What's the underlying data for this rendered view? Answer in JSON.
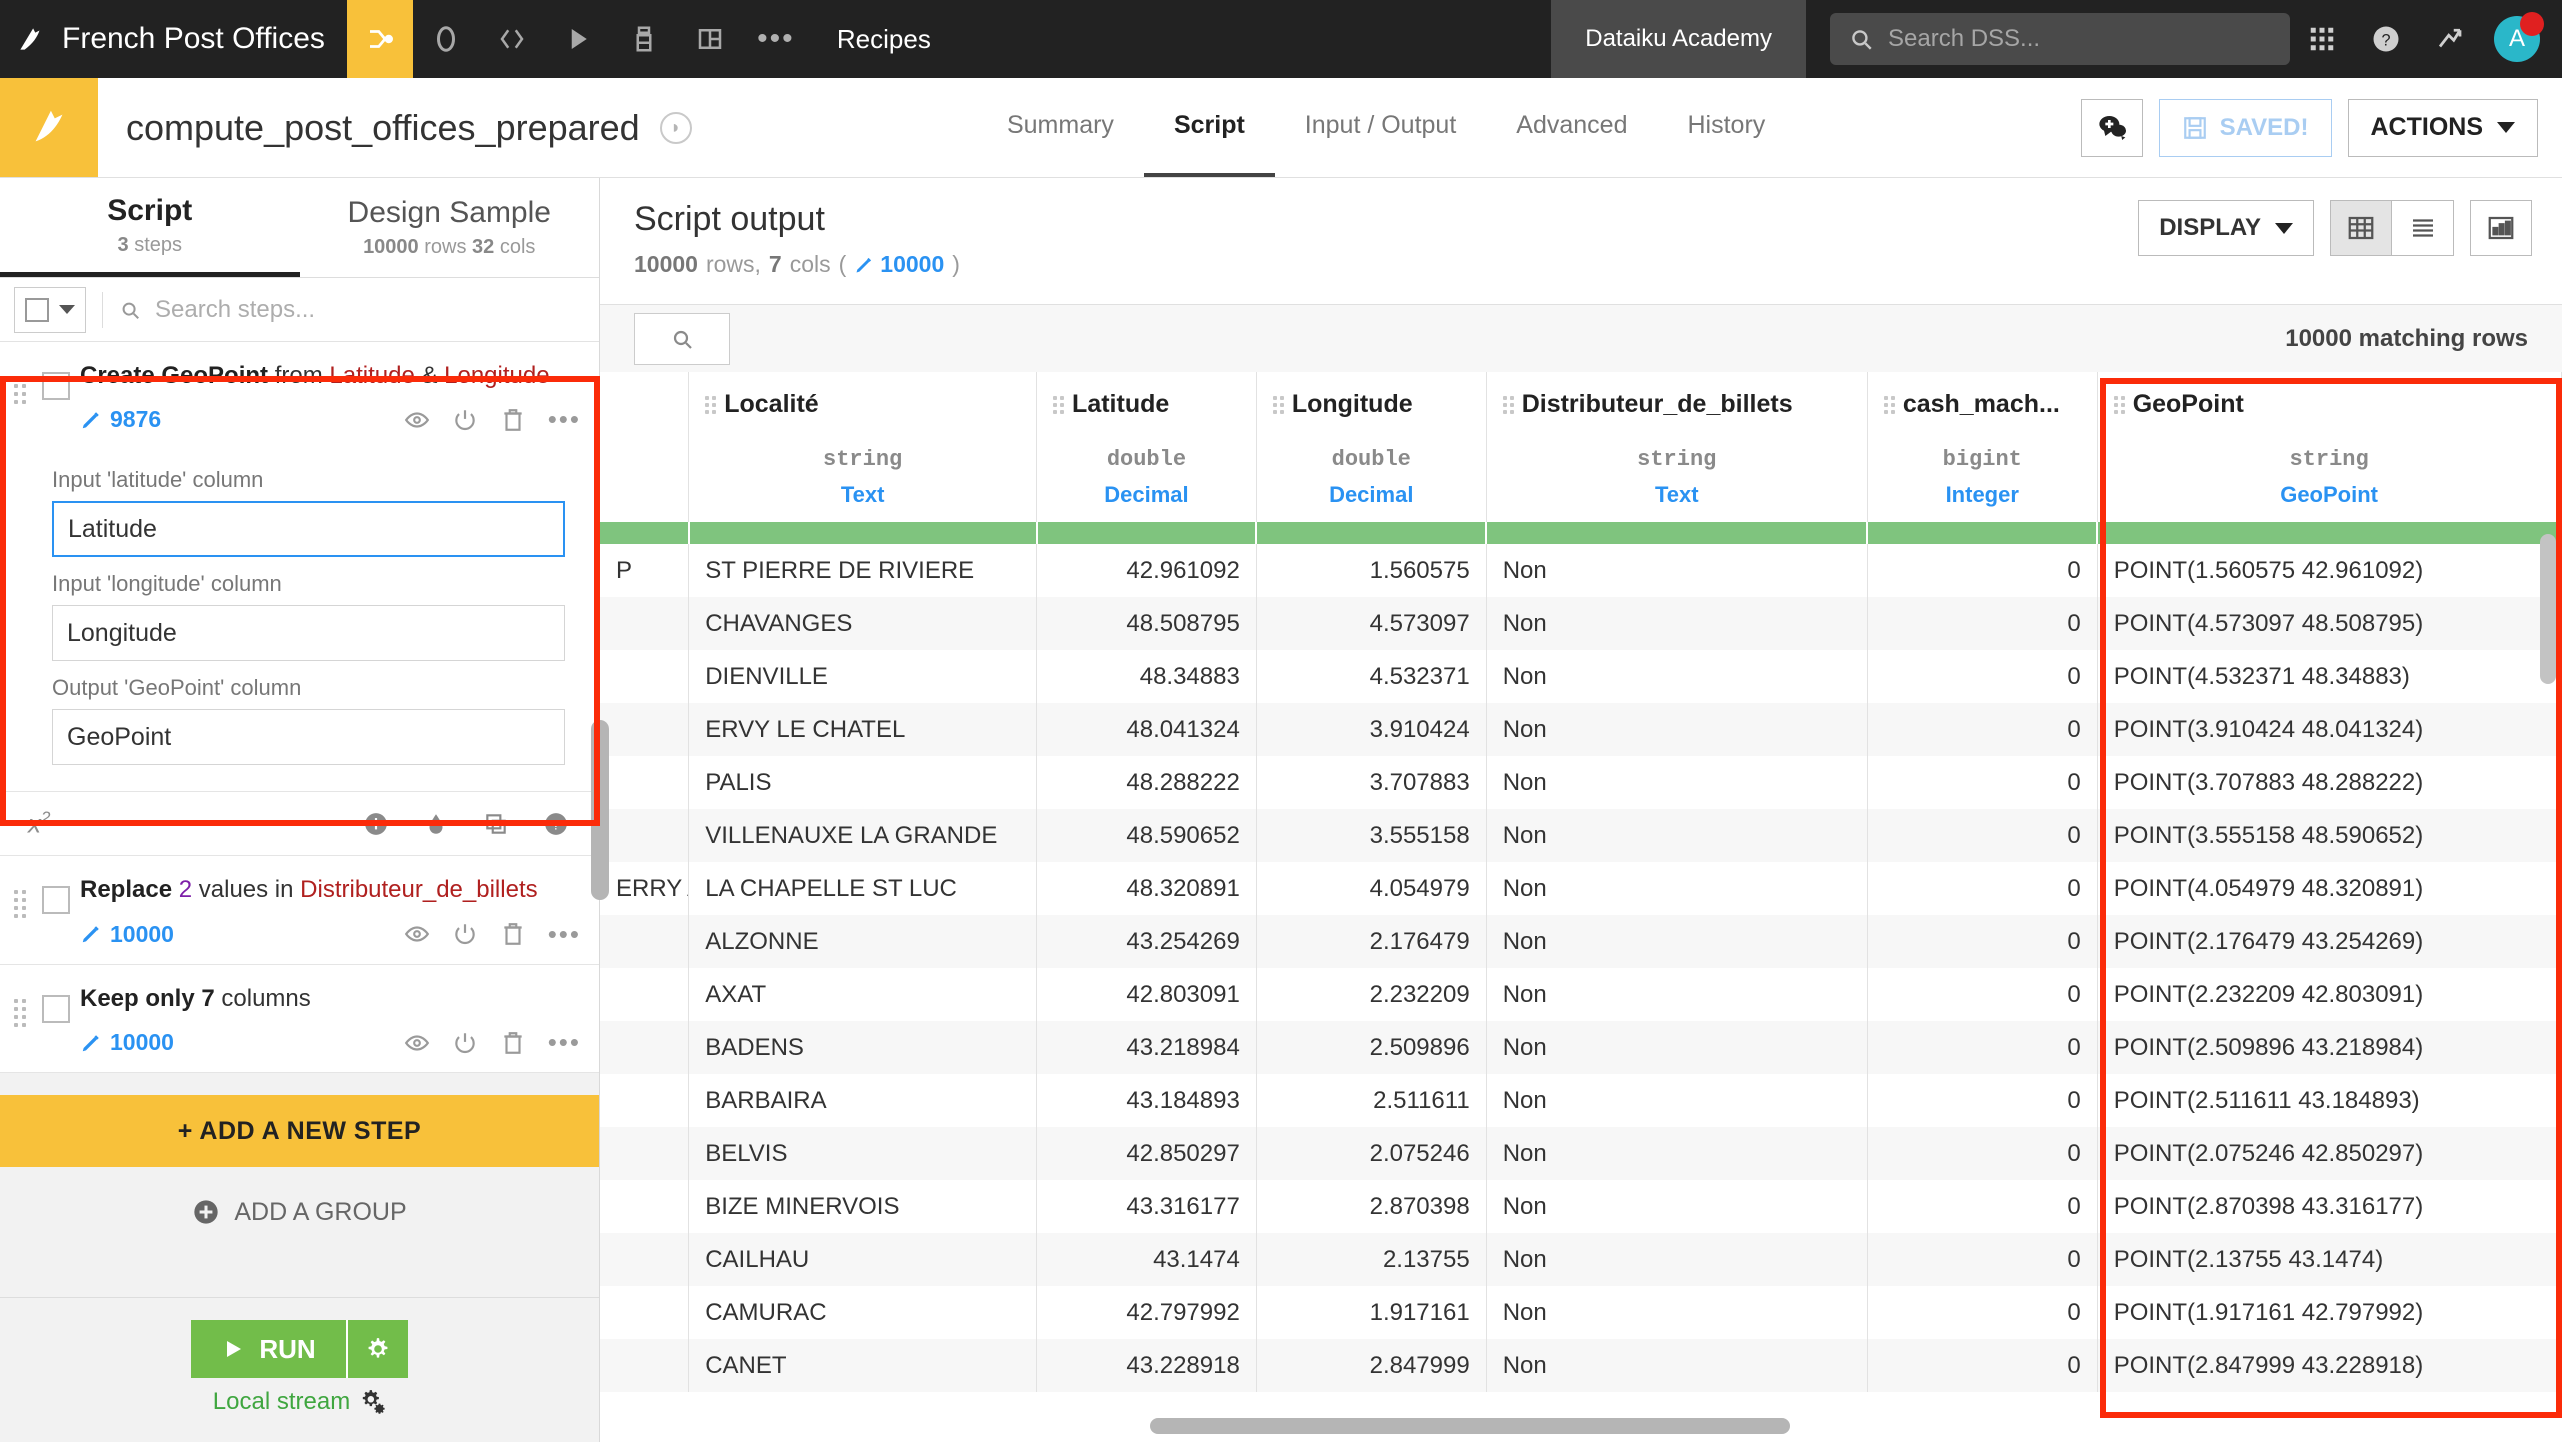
{
  "topnav": {
    "project_name": "French Post Offices",
    "icons": [
      "flow-icon",
      "dataset-icon",
      "code-icon",
      "play-icon",
      "lab-icon",
      "dashboard-icon",
      "more-icon"
    ],
    "section_label": "Recipes",
    "academy_label": "Dataiku Academy",
    "search_placeholder": "Search DSS...",
    "search_value": "",
    "apps_icon": "apps-grid-icon",
    "help_icon": "help-circle-icon",
    "activity_icon": "trending-up-icon",
    "avatar_initial": "A"
  },
  "recipe_header": {
    "title": "compute_post_offices_prepared",
    "tag_icon": "tag-icon",
    "tabs": [
      {
        "label": "Summary",
        "active": false
      },
      {
        "label": "Script",
        "active": true
      },
      {
        "label": "Input / Output",
        "active": false
      },
      {
        "label": "Advanced",
        "active": false
      },
      {
        "label": "History",
        "active": false
      }
    ],
    "discussion_icon": "discussion-add-icon",
    "saved_label": "SAVED!",
    "saved_icon": "floppy-disk-icon",
    "actions_label": "ACTIONS"
  },
  "left_panel": {
    "tabs": [
      {
        "label": "Script",
        "sub_strong": "3",
        "sub_rest": "steps",
        "active": true
      },
      {
        "label": "Design Sample",
        "sub_strong": "10000",
        "sub_rest": "rows",
        "sub_strong2": "32",
        "sub_rest2": "cols",
        "active": false
      }
    ],
    "search_placeholder": "Search steps...",
    "search_value": "",
    "steps": [
      {
        "title_parts": {
          "bold": "Create GeoPoint",
          "mid": " from ",
          "col1": "Latitude",
          "amp": " & ",
          "col2": "Longitude"
        },
        "count": "9876",
        "expanded": true,
        "fields": [
          {
            "label": "Input 'latitude' column",
            "value": "Latitude",
            "focused": true
          },
          {
            "label": "Input 'longitude' column",
            "value": "Longitude",
            "focused": false
          },
          {
            "label": "Output 'GeoPoint' column",
            "value": "GeoPoint",
            "focused": false
          }
        ]
      },
      {
        "title_parts": {
          "bold": "Replace",
          "num": "2",
          "mid": " values in ",
          "col1": "Distributeur_de_billets"
        },
        "count": "10000",
        "expanded": false
      },
      {
        "title_parts": {
          "bold2": "Keep only 7",
          "mid": " columns"
        },
        "count": "10000",
        "expanded": false
      }
    ],
    "formula_bar": {
      "label": "x2",
      "icons": [
        "info-icon",
        "droplet-icon",
        "copy-icon",
        "help-icon"
      ]
    },
    "add_step_label": "+ ADD A NEW STEP",
    "add_group_label": "ADD A GROUP",
    "run_label": "RUN",
    "run_gear_icon": "gear-icon",
    "local_stream_label": "Local stream",
    "local_stream_icon": "gears-icon"
  },
  "script_output": {
    "title": "Script output",
    "rows_count": "10000",
    "rows_label": "rows,",
    "cols_count": "7",
    "cols_label": "cols",
    "sample_count": "10000",
    "display_label": "DISPLAY",
    "matching_rows": "10000 matching rows",
    "search_icon": "search-icon",
    "grid_view_icon": "grid-view-icon",
    "list_view_icon": "list-view-icon",
    "chart_view_icon": "chart-view-icon"
  },
  "table": {
    "columns": [
      {
        "name": "",
        "type": "",
        "meaning": "",
        "key": "idx"
      },
      {
        "name": "Localité",
        "type": "string",
        "meaning": "Text",
        "key": "localite"
      },
      {
        "name": "Latitude",
        "type": "double",
        "meaning": "Decimal",
        "key": "latitude"
      },
      {
        "name": "Longitude",
        "type": "double",
        "meaning": "Decimal",
        "key": "longitude"
      },
      {
        "name": "Distributeur_de_billets",
        "type": "string",
        "meaning": "Text",
        "key": "distributeur"
      },
      {
        "name": "cash_mach...",
        "type": "bigint",
        "meaning": "Integer",
        "key": "cash"
      },
      {
        "name": "GeoPoint",
        "type": "string",
        "meaning": "GeoPoint",
        "key": "geopoint"
      }
    ],
    "rows": [
      {
        "idx": "P",
        "localite": "ST PIERRE DE RIVIERE",
        "latitude": "42.961092",
        "longitude": "1.560575",
        "distributeur": "Non",
        "cash": "0",
        "geopoint": "POINT(1.560575 42.961092)"
      },
      {
        "idx": "",
        "localite": "CHAVANGES",
        "latitude": "48.508795",
        "longitude": "4.573097",
        "distributeur": "Non",
        "cash": "0",
        "geopoint": "POINT(4.573097 48.508795)"
      },
      {
        "idx": "",
        "localite": "DIENVILLE",
        "latitude": "48.34883",
        "longitude": "4.532371",
        "distributeur": "Non",
        "cash": "0",
        "geopoint": "POINT(4.532371 48.34883)"
      },
      {
        "idx": "",
        "localite": "ERVY LE CHATEL",
        "latitude": "48.041324",
        "longitude": "3.910424",
        "distributeur": "Non",
        "cash": "0",
        "geopoint": "POINT(3.910424 48.041324)"
      },
      {
        "idx": "",
        "localite": "PALIS",
        "latitude": "48.288222",
        "longitude": "3.707883",
        "distributeur": "Non",
        "cash": "0",
        "geopoint": "POINT(3.707883 48.288222)"
      },
      {
        "idx": "",
        "localite": "VILLENAUXE LA GRANDE",
        "latitude": "48.590652",
        "longitude": "3.555158",
        "distributeur": "Non",
        "cash": "0",
        "geopoint": "POINT(3.555158 48.590652)"
      },
      {
        "idx": "ERRY AP",
        "localite": "LA CHAPELLE ST LUC",
        "latitude": "48.320891",
        "longitude": "4.054979",
        "distributeur": "Non",
        "cash": "0",
        "geopoint": "POINT(4.054979 48.320891)"
      },
      {
        "idx": "",
        "localite": "ALZONNE",
        "latitude": "43.254269",
        "longitude": "2.176479",
        "distributeur": "Non",
        "cash": "0",
        "geopoint": "POINT(2.176479 43.254269)"
      },
      {
        "idx": "",
        "localite": "AXAT",
        "latitude": "42.803091",
        "longitude": "2.232209",
        "distributeur": "Non",
        "cash": "0",
        "geopoint": "POINT(2.232209 42.803091)"
      },
      {
        "idx": "",
        "localite": "BADENS",
        "latitude": "43.218984",
        "longitude": "2.509896",
        "distributeur": "Non",
        "cash": "0",
        "geopoint": "POINT(2.509896 43.218984)"
      },
      {
        "idx": "",
        "localite": "BARBAIRA",
        "latitude": "43.184893",
        "longitude": "2.511611",
        "distributeur": "Non",
        "cash": "0",
        "geopoint": "POINT(2.511611 43.184893)"
      },
      {
        "idx": "",
        "localite": "BELVIS",
        "latitude": "42.850297",
        "longitude": "2.075246",
        "distributeur": "Non",
        "cash": "0",
        "geopoint": "POINT(2.075246 42.850297)"
      },
      {
        "idx": "",
        "localite": "BIZE MINERVOIS",
        "latitude": "43.316177",
        "longitude": "2.870398",
        "distributeur": "Non",
        "cash": "0",
        "geopoint": "POINT(2.870398 43.316177)"
      },
      {
        "idx": "",
        "localite": "CAILHAU",
        "latitude": "43.1474",
        "longitude": "2.13755",
        "distributeur": "Non",
        "cash": "0",
        "geopoint": "POINT(2.13755 43.1474)"
      },
      {
        "idx": "",
        "localite": "CAMURAC",
        "latitude": "42.797992",
        "longitude": "1.917161",
        "distributeur": "Non",
        "cash": "0",
        "geopoint": "POINT(1.917161 42.797992)"
      },
      {
        "idx": "",
        "localite": "CANET",
        "latitude": "43.228918",
        "longitude": "2.847999",
        "distributeur": "Non",
        "cash": "0",
        "geopoint": "POINT(2.847999 43.228918)"
      }
    ]
  },
  "colors": {
    "brand_yellow": "#f8c13a",
    "nav_dark": "#222222",
    "accent_blue": "#2a92f2",
    "green_bar": "#7fc47e",
    "run_green": "#72bd4a",
    "highlight_red": "#fb2b09",
    "column_red": "#b0201f"
  }
}
